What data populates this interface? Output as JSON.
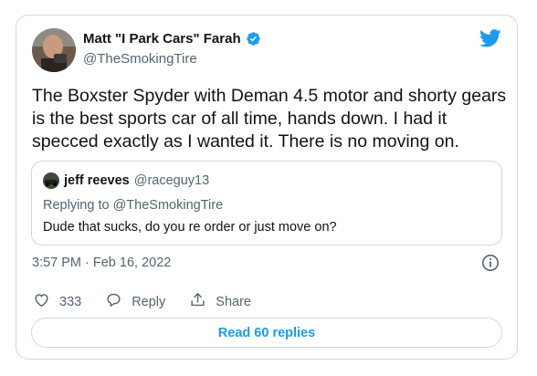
{
  "colors": {
    "brand": "#1d9bf0",
    "text": "#0f1419",
    "secondary": "#536471",
    "border": "#cfd9de"
  },
  "author": {
    "display_name": "Matt \"I Park Cars\" Farah",
    "handle": "@TheSmokingTire",
    "verified": true,
    "avatar_icon": "user-avatar"
  },
  "tweet": {
    "text": "The Boxster Spyder with Deman 4.5 motor and shorty gears is the best sports car of all time, hands down. I had it specced exactly as I wanted it. There is no moving on.",
    "timestamp": "3:57 PM · Feb 16, 2022"
  },
  "quoted": {
    "display_name": "jeff reeves",
    "handle": "@raceguy13",
    "replying_to_prefix": "Replying to",
    "replying_to_handle": "@TheSmokingTire",
    "text": "Dude that sucks, do you re order or just move on?"
  },
  "actions": {
    "like_count": "333",
    "reply_label": "Reply",
    "share_label": "Share"
  },
  "read_replies_label": "Read 60 replies",
  "icons": [
    "twitter-bird-icon",
    "verified-badge-icon",
    "info-icon",
    "heart-icon",
    "reply-bubble-icon",
    "share-icon"
  ]
}
